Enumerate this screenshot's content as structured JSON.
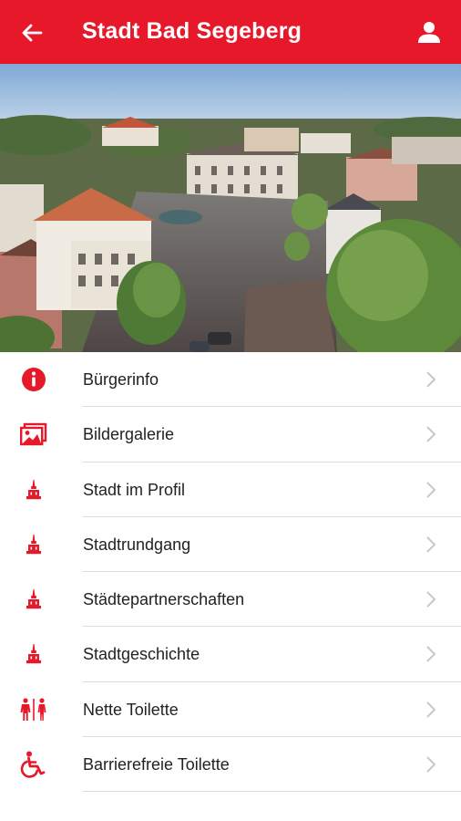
{
  "colors": {
    "accent": "#e8182b",
    "divider": "#dddddd",
    "chevron": "#c8c8c8"
  },
  "appbar": {
    "title": "Stadt Bad Segeberg",
    "back_icon": "arrow-left-icon",
    "profile_icon": "user-icon"
  },
  "hero": {
    "icon": "town-aerial-photo"
  },
  "menu": {
    "items": [
      {
        "label": "Bürgerinfo",
        "icon": "info-circle-icon"
      },
      {
        "label": "Bildergalerie",
        "icon": "image-gallery-icon"
      },
      {
        "label": "Stadt im Profil",
        "icon": "landmark-icon"
      },
      {
        "label": "Stadtrundgang",
        "icon": "landmark-icon"
      },
      {
        "label": "Städtepartnerschaften",
        "icon": "landmark-icon"
      },
      {
        "label": "Stadtgeschichte",
        "icon": "landmark-icon"
      },
      {
        "label": "Nette Toilette",
        "icon": "restroom-icon"
      },
      {
        "label": "Barrierefreie Toilette",
        "icon": "wheelchair-icon"
      }
    ]
  }
}
